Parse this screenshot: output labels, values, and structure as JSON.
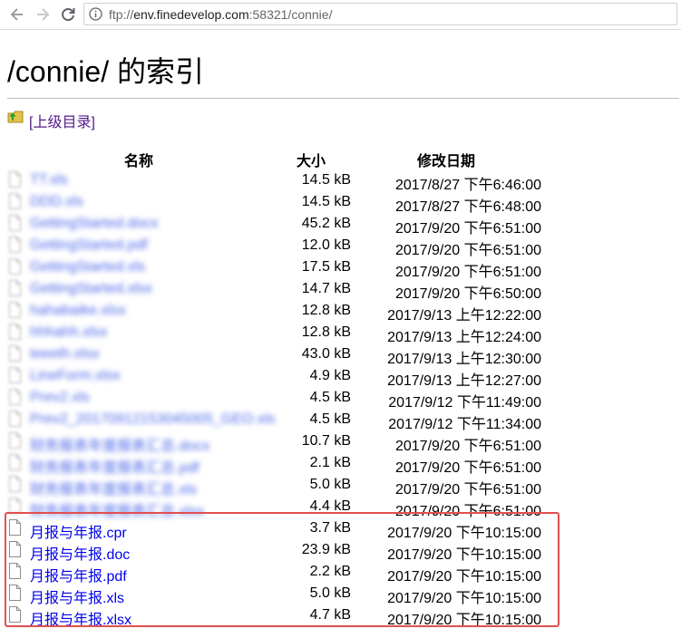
{
  "browser": {
    "url_scheme": "ftp://",
    "url_host": "env.finedevelop.com",
    "url_rest": ":58321/connie/"
  },
  "page": {
    "title": "/connie/ 的索引",
    "parent_link": "[上级目录]"
  },
  "table": {
    "headers": {
      "name": "名称",
      "size": "大小",
      "modified": "修改日期"
    },
    "rows": [
      {
        "name": "TT.xls",
        "size": "14.5 kB",
        "modified": "2017/8/27 下午6:46:00",
        "obscured": true
      },
      {
        "name": "DDD.xls",
        "size": "14.5 kB",
        "modified": "2017/8/27 下午6:48:00",
        "obscured": true
      },
      {
        "name": "GettingStarted.docx",
        "size": "45.2 kB",
        "modified": "2017/9/20 下午6:51:00",
        "obscured": true
      },
      {
        "name": "GettingStarted.pdf",
        "size": "12.0 kB",
        "modified": "2017/9/20 下午6:51:00",
        "obscured": true
      },
      {
        "name": "GettingStarted.xls",
        "size": "17.5 kB",
        "modified": "2017/9/20 下午6:51:00",
        "obscured": true
      },
      {
        "name": "GettingStarted.xlsx",
        "size": "14.7 kB",
        "modified": "2017/9/20 下午6:50:00",
        "obscured": true
      },
      {
        "name": "hahabaike.xlsx",
        "size": "12.8 kB",
        "modified": "2017/9/13 上午12:22:00",
        "obscured": true
      },
      {
        "name": "hhhahh.xlsx",
        "size": "12.8 kB",
        "modified": "2017/9/13 上午12:24:00",
        "obscured": true
      },
      {
        "name": "teeeth.xlsx",
        "size": "43.0 kB",
        "modified": "2017/9/13 上午12:30:00",
        "obscured": true
      },
      {
        "name": "LineForm.xlsx",
        "size": "4.9 kB",
        "modified": "2017/9/13 上午12:27:00",
        "obscured": true
      },
      {
        "name": "Prev2.xls",
        "size": "4.5 kB",
        "modified": "2017/9/12 下午11:49:00",
        "obscured": true
      },
      {
        "name": "Prev2_20170912153045005_GEO.xls",
        "size": "4.5 kB",
        "modified": "2017/9/12 下午11:34:00",
        "obscured": true
      },
      {
        "name": "财务报表年度报表汇总.docx",
        "size": "10.7 kB",
        "modified": "2017/9/20 下午6:51:00",
        "obscured": true
      },
      {
        "name": "财务报表年度报表汇总.pdf",
        "size": "2.1 kB",
        "modified": "2017/9/20 下午6:51:00",
        "obscured": true
      },
      {
        "name": "财务报表年度报表汇总.xls",
        "size": "5.0 kB",
        "modified": "2017/9/20 下午6:51:00",
        "obscured": true
      },
      {
        "name": "财务报表年度报表汇总.xlsx",
        "size": "4.4 kB",
        "modified": "2017/9/20 下午6:51:00",
        "obscured": true
      },
      {
        "name": "月报与年报.cpr",
        "size": "3.7 kB",
        "modified": "2017/9/20 下午10:15:00",
        "obscured": false
      },
      {
        "name": "月报与年报.doc",
        "size": "23.9 kB",
        "modified": "2017/9/20 下午10:15:00",
        "obscured": false
      },
      {
        "name": "月报与年报.pdf",
        "size": "2.2 kB",
        "modified": "2017/9/20 下午10:15:00",
        "obscured": false
      },
      {
        "name": "月报与年报.xls",
        "size": "5.0 kB",
        "modified": "2017/9/20 下午10:15:00",
        "obscured": false
      },
      {
        "name": "月报与年报.xlsx",
        "size": "4.7 kB",
        "modified": "2017/9/20 下午10:15:00",
        "obscured": false
      }
    ]
  },
  "colors": {
    "link": "#0000ee",
    "visited_link": "#551a8b",
    "highlight_box": "#e05050"
  }
}
